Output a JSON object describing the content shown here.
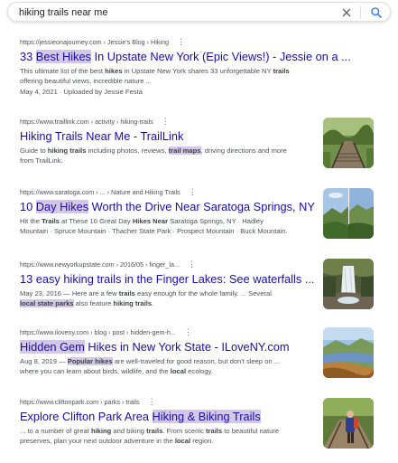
{
  "search": {
    "query": "hiking trails near me",
    "clear_icon": "close-icon",
    "search_icon": "search-icon"
  },
  "results": [
    {
      "cite": "https://jessieonajourney.com › Jessie's Blog › Hiking",
      "title_pre": "33 ",
      "title_hl": "Best Hikes",
      "title_post": " In Upstate New York (Epic Views!) - Jessie on a ...",
      "snippet_1a": "This ultimate list of the best ",
      "snippet_1b": "hikes",
      "snippet_1c": " in Upstate New York shares 33 unforgettable NY ",
      "snippet_1d": "trails",
      "snippet_2": "offering beautiful views, incredible nature ...",
      "date_line": "May 4, 2021 · Uploaded by Jessie Festa"
    },
    {
      "cite": "https://www.traillink.com › activity › hiking-trails",
      "title": "Hiking Trails Near Me - TrailLink",
      "snippet_1a": "Guide to ",
      "snippet_1b": "hiking trails",
      "snippet_1c": " including photos, reviews, ",
      "snippet_1d": "trail maps",
      "snippet_1e": ", driving directions and more",
      "snippet_2": "from TrailLink.",
      "thumb_icon": "bridge-trail-thumbnail"
    },
    {
      "cite": "https://www.saratoga.com › ... › Nature and Hiking Trails",
      "title_pre": "10 ",
      "title_hl": "Day Hikes",
      "title_post": " Worth the Drive Near Saratoga Springs, NY",
      "snippet_1a": "Hit the ",
      "snippet_1b": "Trails",
      "snippet_1c": " at These 10 Great Day ",
      "snippet_1d": "Hikes Near",
      "snippet_1e": " Saratoga Springs, NY · Hadley",
      "snippet_2": "Mountain · Spruce Mountain · Thacher State Park · Prospect Mountain · Buck Mountain.",
      "thumb_icon": "mountain-view-thumbnail"
    },
    {
      "cite": "https://www.newyorkupstate.com › 2016/05 › finger_la...",
      "title": "13 easy hiking trails in the Finger Lakes: See waterfalls ...",
      "snippet_1a": "May 23, 2016 — Here are a few ",
      "snippet_1b": "trails",
      "snippet_1c": " easy enough for the whole family. ... Several",
      "snippet_2a": "local state parks",
      "snippet_2b": " also feature ",
      "snippet_2c": "hiking trails",
      "snippet_2d": ".",
      "thumb_icon": "waterfall-thumbnail"
    },
    {
      "cite": "https://www.iloveny.com › blog › post › hidden-gem-h...",
      "title_hl": "Hidden Gem",
      "title_post": " Hikes in New York State - ILoveNY.com",
      "snippet_1a": "Aug 8, 2019 — ",
      "snippet_1b": "Popular hikes",
      "snippet_1c": " are well-traveled for good reason, but don't sleep on ...",
      "snippet_2a": "where you can learn about birds, wildlife, and the ",
      "snippet_2b": "local",
      "snippet_2c": " ecology.",
      "thumb_icon": "lake-valley-thumbnail"
    },
    {
      "cite": "https://www.cliftonpark.com › parks › trails",
      "title_pre": "Explore Clifton Park Area ",
      "title_hl": "Hiking & Biking Trails",
      "snippet_1a": "... to a number of great ",
      "snippet_1b": "hiking",
      "snippet_1c": " and biking ",
      "snippet_1d": "trails",
      "snippet_1e": ". From scenic ",
      "snippet_1f": "trails",
      "snippet_1g": " to beautiful nature",
      "snippet_2a": "preserves, plan your next outdoor adventure in the ",
      "snippet_2b": "local",
      "snippet_2c": " region.",
      "thumb_icon": "hiker-bridge-thumbnail"
    }
  ],
  "more_icon": "more-vert-icon",
  "colors": {
    "link": "#1a0dab",
    "highlight": "#d3c8e8",
    "snippet": "#4d5156",
    "search_icon": "#4285f4"
  }
}
